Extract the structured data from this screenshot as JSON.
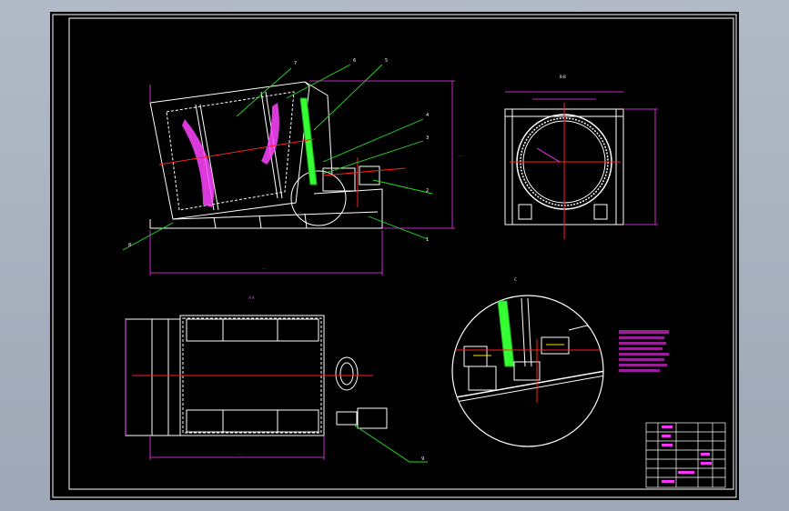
{
  "drawing": {
    "colors": {
      "background": "#000000",
      "border": "#ffffff",
      "body": "#ffffff",
      "dimension": "#ff33ff",
      "centerline": "#ff2020",
      "leader": "#22dd22",
      "spring": "#ff44ff",
      "accent_green": "#33ff33",
      "note_text": "#ff33ff",
      "title_block": "#ffffff"
    },
    "main_view": {
      "callouts": [
        "7",
        "6",
        "5",
        "4",
        "3",
        "2",
        "1",
        "8"
      ]
    },
    "section_view": {
      "label": "B-B"
    },
    "plan_view": {
      "label": "A-A",
      "callouts": [
        "9"
      ]
    },
    "detail_view": {
      "label": "C"
    }
  }
}
